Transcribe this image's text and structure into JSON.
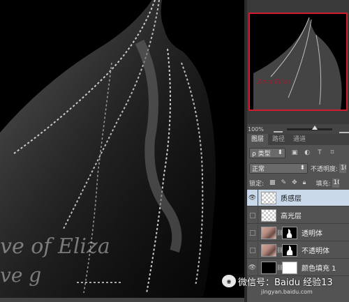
{
  "canvas": {
    "watermark_line1": "ve of Eliza",
    "watermark_line2": "ve g"
  },
  "navigator": {
    "zoom": "100%",
    "zoom_level": 0.62
  },
  "tabs": [
    "图层",
    "路径",
    "通道"
  ],
  "filter": {
    "kind_label": "ρ 类型",
    "icons": [
      "image-filter-icon",
      "adjustment-filter-icon",
      "type-filter-icon",
      "shape-filter-icon"
    ]
  },
  "blend": {
    "mode": "正常",
    "opacity_label": "不透明度:",
    "opacity_value": "10"
  },
  "lock": {
    "label": "锁定:",
    "fill_label": "填充:",
    "fill_value": "10"
  },
  "layers": [
    {
      "name": "质感层",
      "selected": true,
      "visible": true,
      "thumb": "checker",
      "mask": ""
    },
    {
      "name": "高光层",
      "selected": false,
      "visible": false,
      "thumb": "checker",
      "mask": ""
    },
    {
      "name": "透明体",
      "selected": false,
      "visible": false,
      "thumb": "photo",
      "mask": "black"
    },
    {
      "name": "不透明体",
      "selected": false,
      "visible": false,
      "thumb": "photo",
      "mask": "black"
    },
    {
      "name": "颜色填充 1",
      "selected": false,
      "visible": true,
      "thumb": "black",
      "mask": "white"
    }
  ],
  "watermark": {
    "wechat": "微信号：",
    "overlay": "Baidu 经验",
    "number": "13",
    "url": "jingyan.baidu.com"
  },
  "colors": {
    "panel_bg": "#535353",
    "selected_layer": "#c9d9ea",
    "navigator_frame": "#d01c2c"
  }
}
